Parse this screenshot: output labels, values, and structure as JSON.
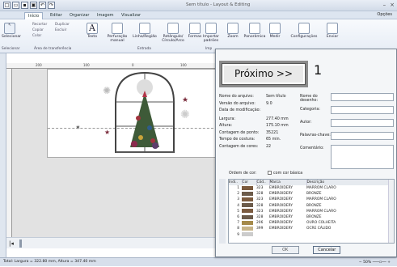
{
  "window": {
    "title": "Sem título - Layout & Editing",
    "qat_icons": [
      "new-icon",
      "open-icon",
      "save-icon",
      "print-icon",
      "undo-icon",
      "redo-icon"
    ]
  },
  "tabs": [
    "Início",
    "Editar",
    "Organizar",
    "Imagem",
    "Visualizar"
  ],
  "options_label": "Opções",
  "ribbon": {
    "selecionar": "Selecionar",
    "recortar": "Recortar",
    "copiar": "Copiar",
    "colar": "Colar",
    "duplicar": "Duplicar",
    "excluir": "Excluir",
    "texto": "Texto",
    "perfuracao": "Perfuração manual",
    "linha_regiao": "Linha/Região",
    "retangulo": "Retângulo/ Círculo/Arco",
    "formas": "Formas",
    "importar": "Importar padrões",
    "zoom": "Zoom",
    "panoramica": "Panorâmica",
    "medir": "Medir",
    "configuracoes": "Configurações",
    "enviar": "Enviar",
    "group_selecionar": "Selecionar",
    "group_transferencia": "Área de transferência",
    "group_entrada": "Entrada",
    "group_imp": "Imp"
  },
  "ruler": {
    "top_labels": [
      "200",
      "100",
      "0",
      "100"
    ]
  },
  "status_bar": {
    "size_text": "Total: Largura = 322.80 mm, Altura = 347.40 mm",
    "zoom": "50%"
  },
  "dialog": {
    "next_label": "Próximo >>",
    "step_number": "1",
    "fields": [
      {
        "label": "Nome do arquivo:",
        "value": "Sem título"
      },
      {
        "label": "Versão do arquivo:",
        "value": "9.0"
      },
      {
        "label": "Data de modificação:",
        "value": ""
      },
      {
        "label": "Largura:",
        "value": "277.40 mm"
      },
      {
        "label": "Altura:",
        "value": "175.10 mm"
      },
      {
        "label": "Contagem de ponto:",
        "value": "35221"
      },
      {
        "label": "Tempo de costura:",
        "value": "65 min."
      },
      {
        "label": "Contagem de cores:",
        "value": "22"
      }
    ],
    "right_fields": [
      "Nome do desenho:",
      "Categoria:",
      "Autor:",
      "Palavras-chave:",
      "Comentário:"
    ],
    "color_order_label": "Ordem de cor:",
    "basic_color_label": "com cor básica",
    "table_headers": [
      "Indi..",
      "Cor",
      "Cód..",
      "Marca",
      "Descrição"
    ],
    "table_rows": [
      {
        "idx": "1",
        "color": "#7b5a3e",
        "code": "323",
        "brand": "EMBROIDERY",
        "desc": "MARROM CLARO"
      },
      {
        "idx": "2",
        "color": "#6c5b4a",
        "code": "328",
        "brand": "EMBROIDERY",
        "desc": "BRONZE"
      },
      {
        "idx": "3",
        "color": "#7b5a3e",
        "code": "323",
        "brand": "EMBROIDERY",
        "desc": "MARROM CLARO"
      },
      {
        "idx": "4",
        "color": "#6c5b4a",
        "code": "328",
        "brand": "EMBROIDERY",
        "desc": "BRONZE"
      },
      {
        "idx": "5",
        "color": "#7b5a3e",
        "code": "323",
        "brand": "EMBROIDERY",
        "desc": "MARROM CLARO"
      },
      {
        "idx": "6",
        "color": "#6c5b4a",
        "code": "328",
        "brand": "EMBROIDERY",
        "desc": "BRONZE"
      },
      {
        "idx": "7",
        "color": "#a58a4a",
        "code": "206",
        "brand": "EMBROIDERY",
        "desc": "OURO COLHEITA"
      },
      {
        "idx": "8",
        "color": "#c7b489",
        "code": "399",
        "brand": "EMBROIDERY",
        "desc": "OCRE CÁLIDO"
      },
      {
        "idx": "9",
        "color": "#cccccc",
        "code": "",
        "brand": "",
        "desc": ""
      }
    ],
    "ok_label": "OK",
    "cancel_label": "Cancelar"
  }
}
